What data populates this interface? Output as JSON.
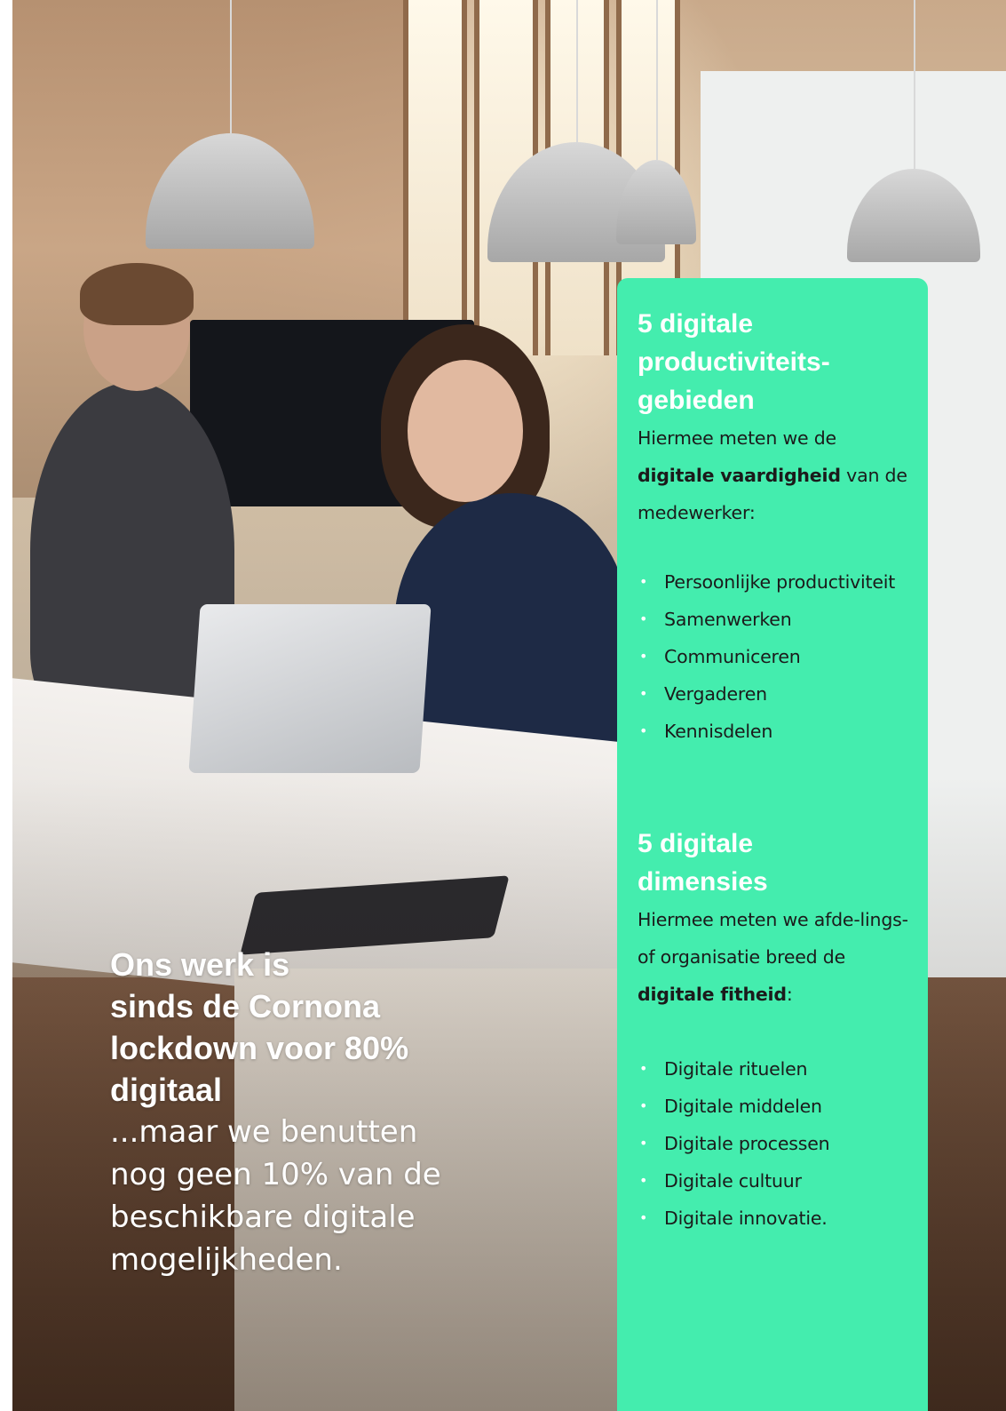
{
  "panel": {
    "section1": {
      "heading": [
        "5 digitale",
        "productiviteits-",
        "gebieden"
      ],
      "intro_plain1": "Hiermee meten we de ",
      "intro_bold": "digitale vaardigheid",
      "intro_plain2": " van de medewerker:",
      "items": [
        "Persoonlijke productiviteit",
        "Samenwerken",
        "Communiceren",
        "Vergaderen",
        "Kennisdelen"
      ]
    },
    "section2": {
      "heading": [
        "5 digitale",
        "dimensies"
      ],
      "intro_plain1": "Hiermee meten we afde-lings- of organisatie breed de ",
      "intro_bold": "digitale fitheid",
      "intro_plain2": ":",
      "items": [
        "Digitale rituelen",
        "Digitale middelen",
        "Digitale processen",
        "Digitale cultuur",
        "Digitale innovatie."
      ]
    },
    "bullet_glyph": "•",
    "background_color": "#44edae"
  },
  "headline": {
    "bold_lines": [
      "Ons werk is",
      "sinds de Cornona",
      "lockdown voor 80%",
      "digitaal"
    ],
    "light_lines": [
      "...maar we benutten",
      "nog geen 10% van de",
      "beschikbare digitale",
      "mogelijkheden."
    ]
  }
}
